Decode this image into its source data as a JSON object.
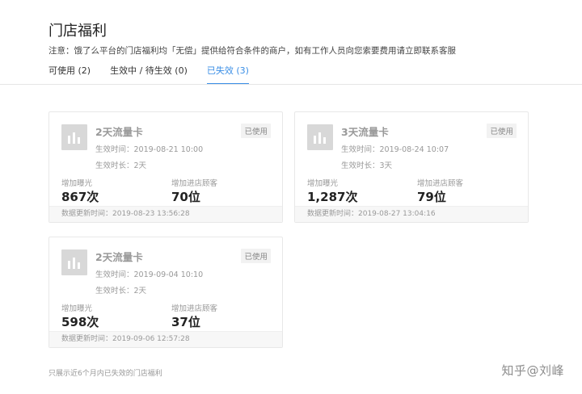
{
  "page": {
    "title": "门店福利",
    "notice": "注意：饿了么平台的门店福利均「无偿」提供给符合条件的商户，如有工作人员向您索要费用请立即联系客服"
  },
  "tabs": [
    {
      "label": "可使用 (2)"
    },
    {
      "label": "生效中 / 待生效 (0)"
    },
    {
      "label": "已失效 (3)"
    }
  ],
  "cards": [
    {
      "name": "2天流量卡",
      "badge": "已使用",
      "start": "生效时间：2019-08-21 10:00",
      "duration": "生效时长：2天",
      "stat_a_label": "增加曝光",
      "stat_a_value": "867次",
      "stat_b_label": "增加进店顾客",
      "stat_b_value": "70位",
      "updated": "数据更新时间：2019-08-23 13:56:28"
    },
    {
      "name": "3天流量卡",
      "badge": "已使用",
      "start": "生效时间：2019-08-24 10:07",
      "duration": "生效时长：3天",
      "stat_a_label": "增加曝光",
      "stat_a_value": "1,287次",
      "stat_b_label": "增加进店顾客",
      "stat_b_value": "79位",
      "updated": "数据更新时间：2019-08-27 13:04:16"
    },
    {
      "name": "2天流量卡",
      "badge": "已使用",
      "start": "生效时间：2019-09-04 10:10",
      "duration": "生效时长：2天",
      "stat_a_label": "增加曝光",
      "stat_a_value": "598次",
      "stat_b_label": "增加进店顾客",
      "stat_b_value": "37位",
      "updated": "数据更新时间：2019-09-06 12:57:28"
    }
  ],
  "footnote": "只展示近6个月内已失效的门店福利",
  "watermark": "知乎@刘峰"
}
